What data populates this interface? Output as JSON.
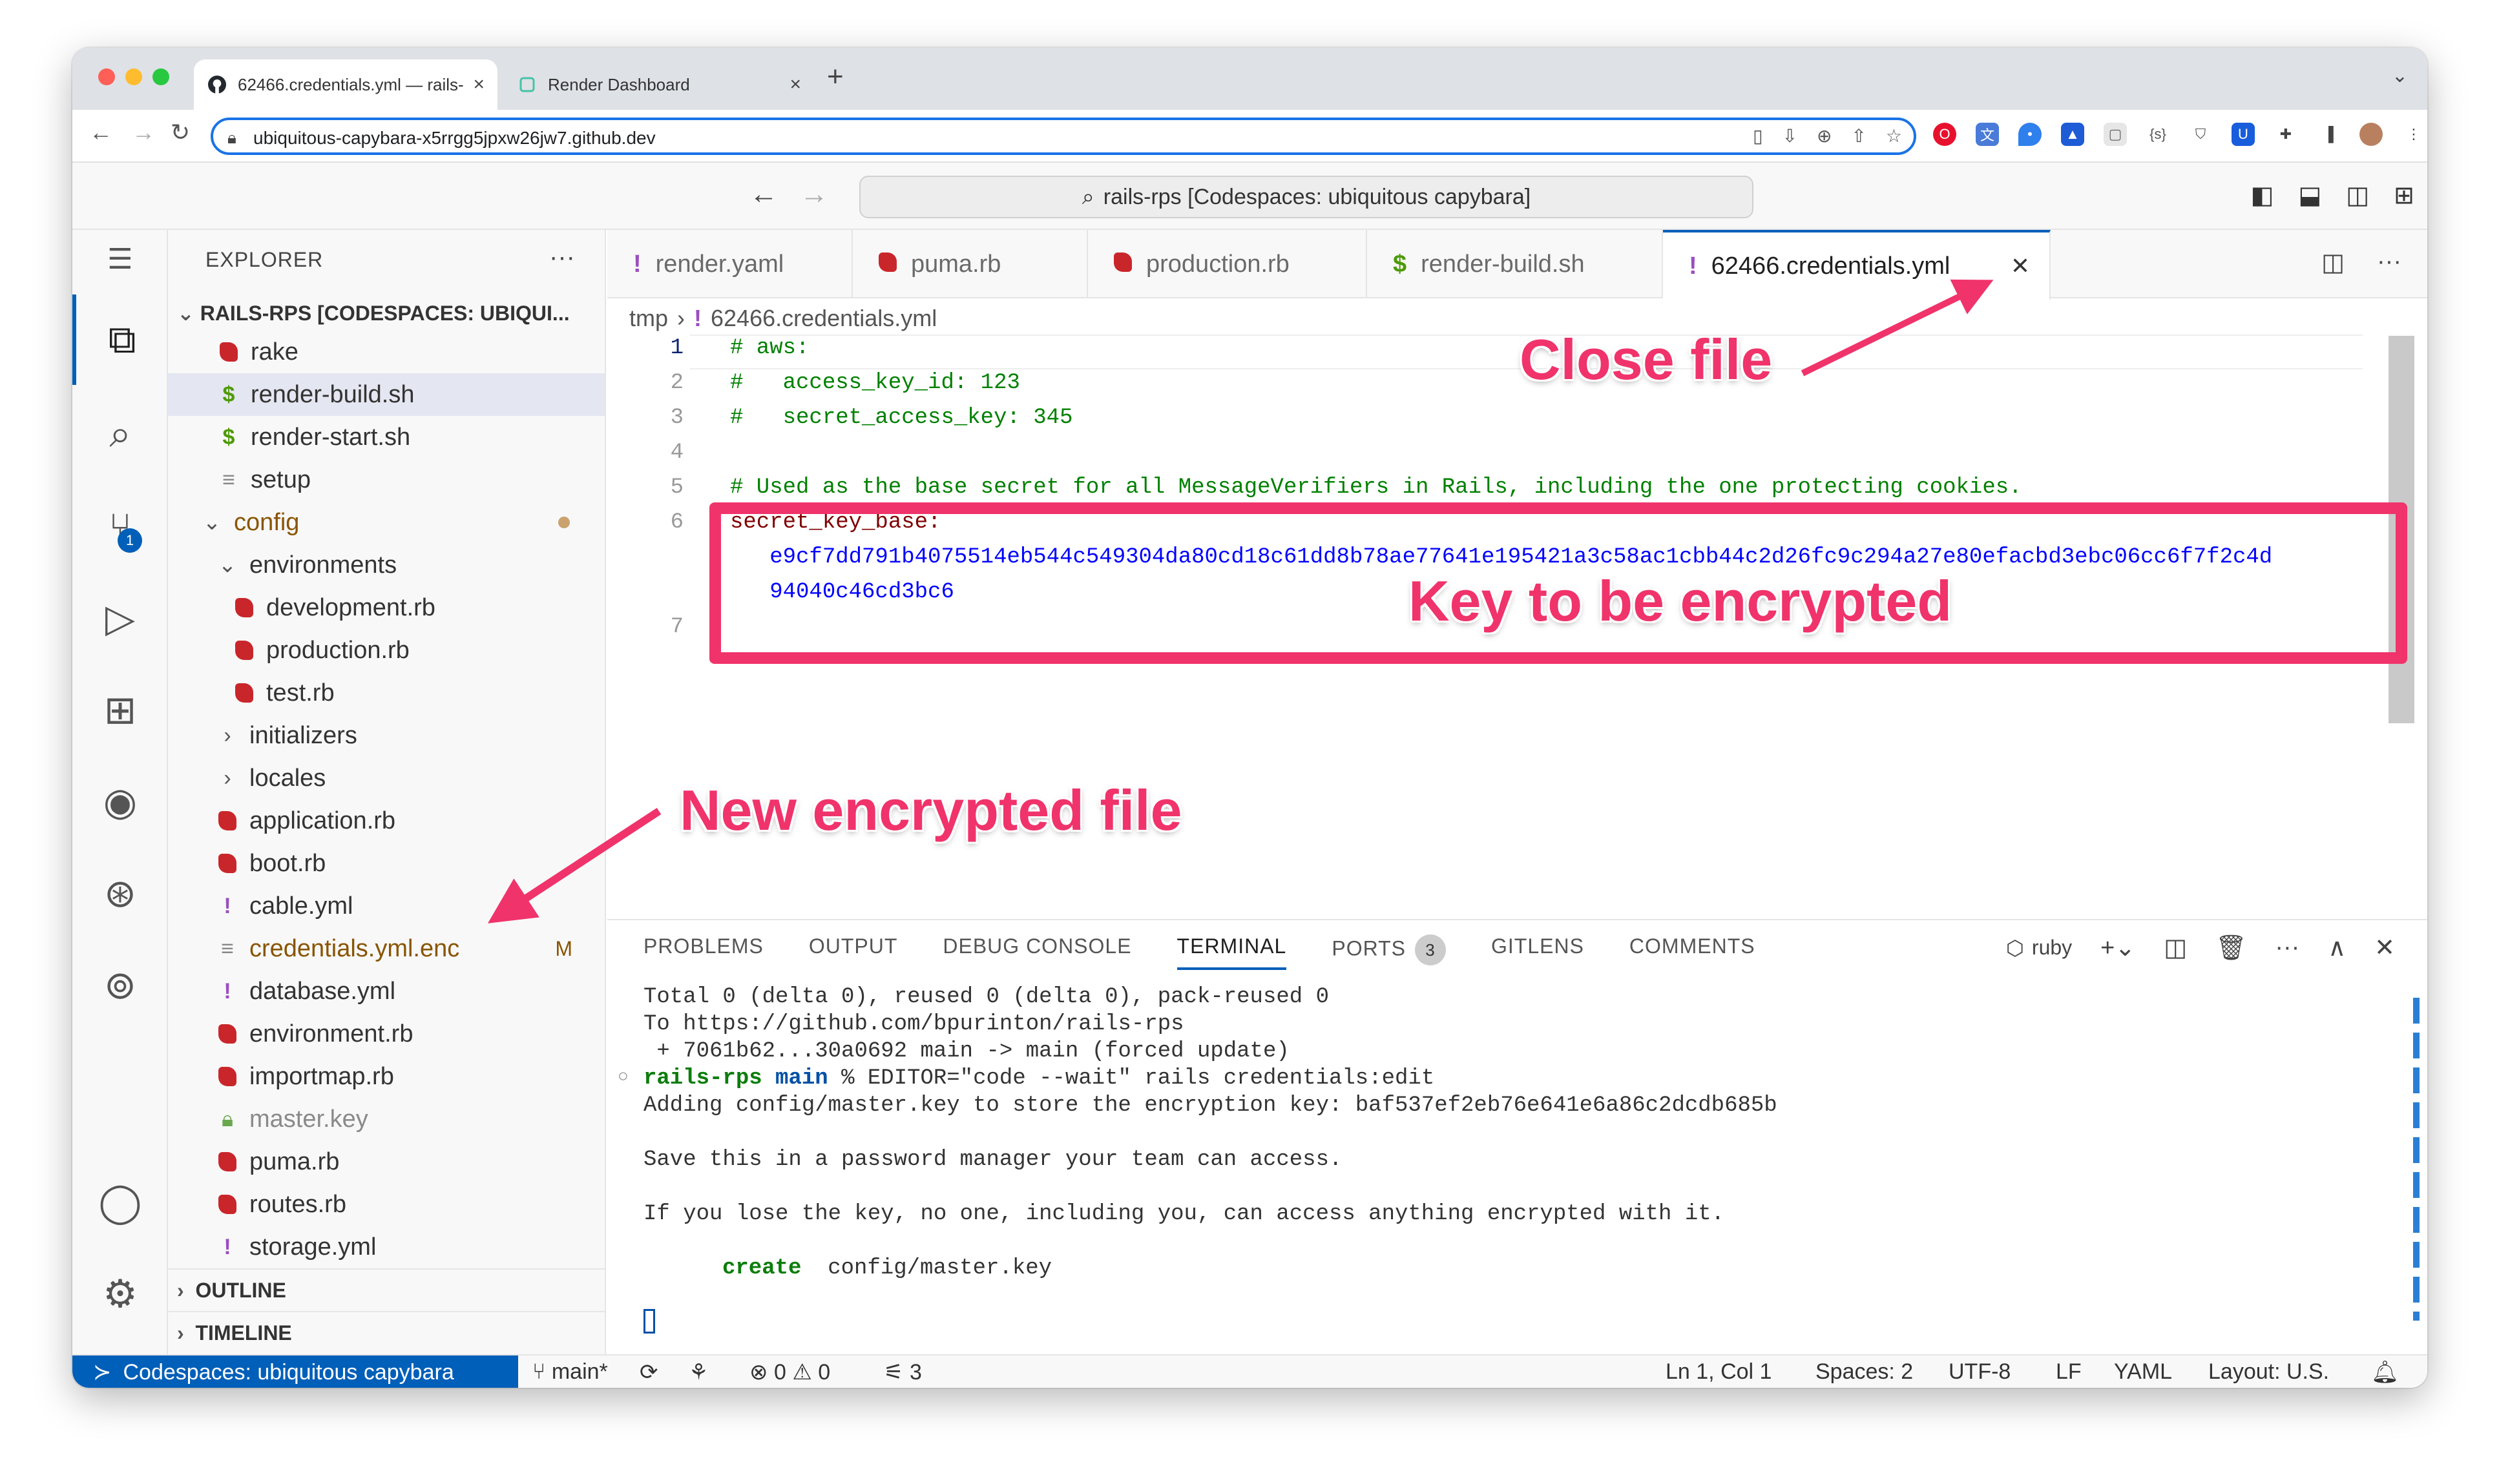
{
  "browser": {
    "tabs": [
      {
        "label": "62466.credentials.yml — rails-",
        "active": true
      },
      {
        "label": "Render Dashboard",
        "active": false
      }
    ],
    "url": "ubiquitous-capybara-x5rrgg5jpxw26jw7.github.dev"
  },
  "vscode": {
    "command_center": "rails-rps [Codespaces: ubiquitous capybara]",
    "explorer": {
      "title": "EXPLORER",
      "root": "RAILS-RPS [CODESPACES: UBIQUI...",
      "items": [
        {
          "label": "rake",
          "icon": "ruby"
        },
        {
          "label": "render-build.sh",
          "icon": "shell",
          "selected": true
        },
        {
          "label": "render-start.sh",
          "icon": "shell"
        },
        {
          "label": "setup",
          "icon": "text"
        },
        {
          "label": "config",
          "icon": "folder-open"
        },
        {
          "label": "environments",
          "icon": "folder-open"
        },
        {
          "label": "development.rb",
          "icon": "ruby"
        },
        {
          "label": "production.rb",
          "icon": "ruby"
        },
        {
          "label": "test.rb",
          "icon": "ruby"
        },
        {
          "label": "initializers",
          "icon": "folder"
        },
        {
          "label": "locales",
          "icon": "folder"
        },
        {
          "label": "application.rb",
          "icon": "ruby"
        },
        {
          "label": "boot.rb",
          "icon": "ruby"
        },
        {
          "label": "cable.yml",
          "icon": "yaml"
        },
        {
          "label": "credentials.yml.enc",
          "icon": "text",
          "status": "M"
        },
        {
          "label": "database.yml",
          "icon": "yaml"
        },
        {
          "label": "environment.rb",
          "icon": "ruby"
        },
        {
          "label": "importmap.rb",
          "icon": "ruby"
        },
        {
          "label": "master.key",
          "icon": "lock"
        },
        {
          "label": "puma.rb",
          "icon": "ruby"
        },
        {
          "label": "routes.rb",
          "icon": "ruby"
        },
        {
          "label": "storage.yml",
          "icon": "yaml"
        }
      ],
      "sections": [
        "OUTLINE",
        "TIMELINE"
      ]
    },
    "editor_tabs": [
      {
        "label": "render.yaml",
        "icon": "yaml"
      },
      {
        "label": "puma.rb",
        "icon": "ruby"
      },
      {
        "label": "production.rb",
        "icon": "ruby"
      },
      {
        "label": "render-build.sh",
        "icon": "shell"
      },
      {
        "label": "62466.credentials.yml",
        "icon": "yaml",
        "active": true
      }
    ],
    "breadcrumb": [
      "tmp",
      "62466.credentials.yml"
    ],
    "code_lines": [
      {
        "num": "1",
        "text": "# aws:",
        "kind": "comment"
      },
      {
        "num": "2",
        "text": "#   access_key_id: 123",
        "kind": "comment"
      },
      {
        "num": "3",
        "text": "#   secret_access_key: 345",
        "kind": "comment"
      },
      {
        "num": "4",
        "text": "",
        "kind": "plain"
      },
      {
        "num": "5",
        "text": "# Used as the base secret for all MessageVerifiers in Rails, including the one protecting cookies.",
        "kind": "comment"
      },
      {
        "num": "6",
        "text": "secret_key_base:",
        "kind": "key"
      },
      {
        "num": "",
        "text": "   e9cf7dd791b4075514eb544c549304da80cd18c61dd8b78ae77641e195421a3c58ac1cbb44c2d26fc9c294a27e80efacbd3ebc06cc6f7f2c4d",
        "kind": "value"
      },
      {
        "num": "",
        "text": "   94040c46cd3bc6",
        "kind": "value"
      },
      {
        "num": "7",
        "text": "",
        "kind": "plain"
      }
    ],
    "panel_tabs": [
      "PROBLEMS",
      "OUTPUT",
      "DEBUG CONSOLE",
      "TERMINAL",
      "PORTS",
      "GITLENS",
      "COMMENTS"
    ],
    "ports_count": "3",
    "terminal_name": "ruby",
    "terminal": {
      "line1": "Total 0 (delta 0), reused 0 (delta 0), pack-reused 0",
      "line2": "To https://github.com/bpurinton/rails-rps",
      "line3": " + 7061b62...30a0692 main -> main (forced update)",
      "prompt_dir": "rails-rps",
      "prompt_branch": "main",
      "prompt_cmd": " % EDITOR=\"code --wait\" rails credentials:edit",
      "line5": "Adding config/master.key to store the encryption key: baf537ef2eb76e641e6a86c2dcdb685b",
      "line6": "Save this in a password manager your team can access.",
      "line7": "If you lose the key, no one, including you, can access anything encrypted with it.",
      "create_word": "create",
      "create_path": "  config/master.key"
    },
    "status": {
      "remote": "Codespaces: ubiquitous capybara",
      "branch": "main*",
      "errors": "0",
      "warnings": "0",
      "ports": "3",
      "position": "Ln 1, Col 1",
      "spaces": "Spaces: 2",
      "encoding": "UTF-8",
      "eol": "LF",
      "language": "YAML",
      "layout": "Layout: U.S."
    }
  },
  "annotations": {
    "close_file": "Close file",
    "key_to_encrypt": "Key to be encrypted",
    "new_file": "New encrypted file",
    "color": "#f0336b"
  }
}
